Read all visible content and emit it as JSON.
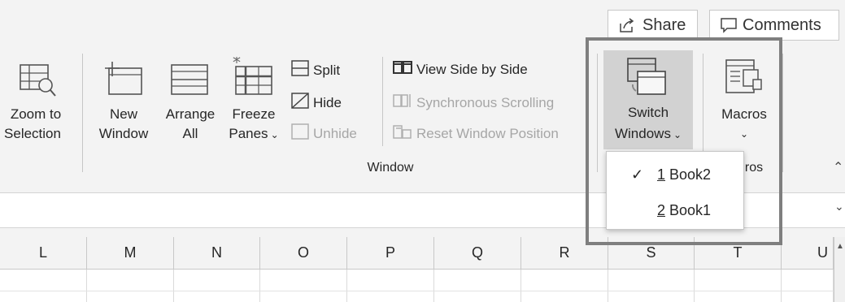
{
  "header": {
    "share_label": "Share",
    "comments_label": "Comments"
  },
  "ribbon": {
    "zoom_selection": {
      "line1": "Zoom to",
      "line2": "Selection"
    },
    "new_window": {
      "line1": "New",
      "line2": "Window"
    },
    "arrange_all": {
      "line1": "Arrange",
      "line2": "All"
    },
    "freeze_panes": {
      "line1": "Freeze",
      "line2": "Panes"
    },
    "split": "Split",
    "hide": "Hide",
    "unhide": "Unhide",
    "view_side_by_side": "View Side by Side",
    "synchronous_scrolling": "Synchronous Scrolling",
    "reset_window_position": "Reset Window Position",
    "switch_windows": {
      "line1": "Switch",
      "line2": "Windows"
    },
    "macros": {
      "line1": "Macros"
    },
    "window_group_label": "Window",
    "macros_group_label_partial": "ros"
  },
  "switch_windows_menu": {
    "items": [
      {
        "number": "1",
        "name": "Book2",
        "checked": true
      },
      {
        "number": "2",
        "name": "Book1",
        "checked": false
      }
    ]
  },
  "columns": [
    "L",
    "M",
    "N",
    "O",
    "P",
    "Q",
    "R",
    "S",
    "T",
    "U"
  ],
  "colors": {
    "ribbon_bg": "#f3f3f3",
    "highlight_border": "#7f7f7f",
    "pressed_bg": "#d2d2d2"
  }
}
